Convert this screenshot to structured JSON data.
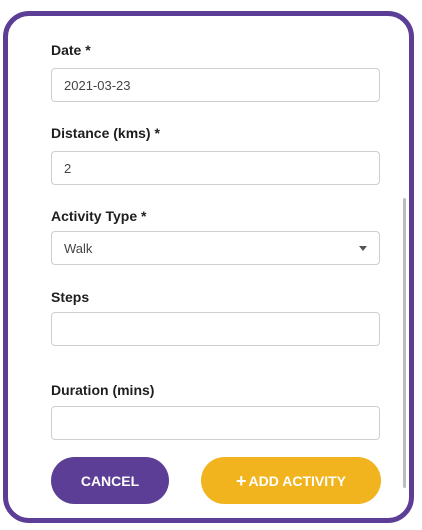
{
  "form": {
    "date": {
      "label": "Date *",
      "value": "2021-03-23"
    },
    "distance": {
      "label": "Distance (kms) *",
      "value": "2"
    },
    "activity_type": {
      "label": "Activity Type *",
      "value": "Walk"
    },
    "steps": {
      "label": "Steps",
      "value": ""
    },
    "duration": {
      "label": "Duration (mins)",
      "value": ""
    }
  },
  "actions": {
    "cancel_label": "CANCEL",
    "add_label": "ADD ACTIVITY",
    "add_icon": "plus-icon"
  },
  "colors": {
    "primary": "#5c3e96",
    "accent": "#f1b41e"
  }
}
